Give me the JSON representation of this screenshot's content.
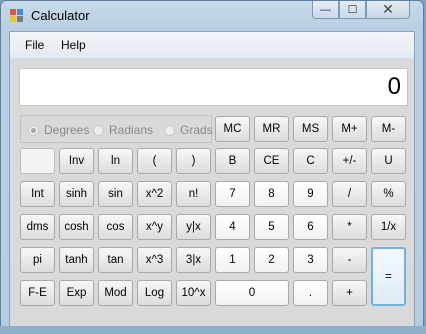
{
  "window": {
    "title": "Calculator",
    "controls": {
      "minimize": "—",
      "maximize": "☐",
      "close": "✕"
    }
  },
  "menu": {
    "items": [
      "File",
      "Help"
    ]
  },
  "display": {
    "value": "0"
  },
  "angle_modes": {
    "options": [
      "Degrees",
      "Radians",
      "Grads"
    ],
    "selected": "Degrees"
  },
  "buttons": {
    "mc": "MC",
    "mr": "MR",
    "ms": "MS",
    "mplus": "M+",
    "mminus": "M-",
    "inv": "Inv",
    "ln": "ln",
    "lparen": "(",
    "rparen": ")",
    "back": "B",
    "ce": "CE",
    "c": "C",
    "plusminus": "+/-",
    "sqrt": "U",
    "int": "Int",
    "sinh": "sinh",
    "sin": "sin",
    "x2": "x^2",
    "fact": "n!",
    "seven": "7",
    "eight": "8",
    "nine": "9",
    "div": "/",
    "percent": "%",
    "dms": "dms",
    "cosh": "cosh",
    "cos": "cos",
    "xy": "x^y",
    "yroot": "y|x",
    "four": "4",
    "five": "5",
    "six": "6",
    "mul": "*",
    "recip": "1/x",
    "pi": "pi",
    "tanh": "tanh",
    "tan": "tan",
    "x3": "x^3",
    "cuberoot": "3|x",
    "one": "1",
    "two": "2",
    "three": "3",
    "minus": "-",
    "fe": "F-E",
    "exp": "Exp",
    "mod": "Mod",
    "log": "Log",
    "tenx": "10^x",
    "zero": "0",
    "dot": ".",
    "plus": "+",
    "equals": "="
  }
}
